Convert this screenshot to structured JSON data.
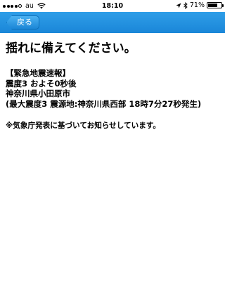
{
  "status_bar": {
    "carrier": "au",
    "time": "18:10",
    "battery_percent": "71%",
    "battery_level": 0.71,
    "icons": [
      "signal-dots-icon",
      "wifi-icon",
      "location-arrow-icon",
      "bluetooth-icon",
      "battery-icon"
    ]
  },
  "nav": {
    "back_label": "戻る",
    "accent_color": "#1a86d8"
  },
  "content": {
    "heading": "揺れに備えてください。",
    "alert_lines": [
      "【緊急地震速報】",
      "震度3 およそ0秒後",
      "神奈川県小田原市",
      "(最大震度3 震源地:神奈川県西部 18時7分27秒発生)"
    ],
    "note": "※気象庁発表に基づいてお知らせしています。"
  }
}
